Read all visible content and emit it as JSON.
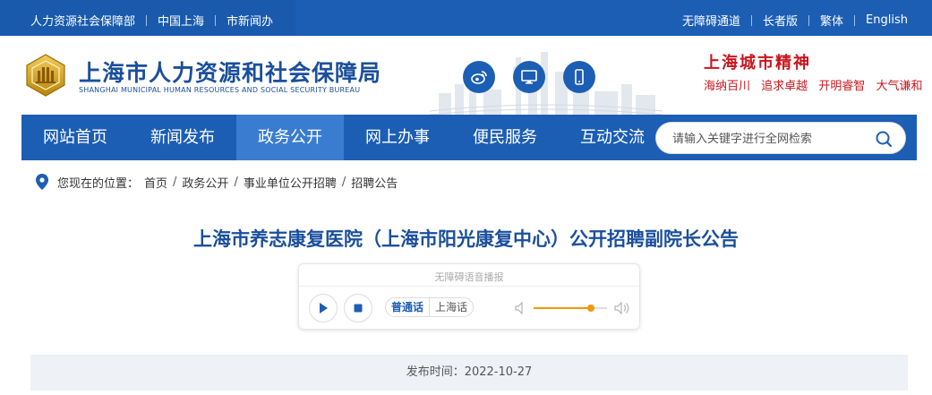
{
  "topbar": {
    "left_links": [
      "人力资源社会保障部",
      "中国上海",
      "市新闻办"
    ],
    "right_links": [
      "无障碍通道",
      "长者版",
      "繁体",
      "English"
    ]
  },
  "header": {
    "title_cn": "上海市人力资源和社会保障局",
    "title_en": "SHANGHAI MUNICIPAL HUMAN RESOURCES AND SOCIAL SECURITY BUREAU",
    "spirit_title": "上海城市精神",
    "spirit_items": [
      "海纳百川",
      "追求卓越",
      "开明睿智",
      "大气谦和"
    ],
    "icons": [
      "weibo-icon",
      "desktop-icon",
      "mobile-icon"
    ]
  },
  "nav": {
    "items": [
      "网站首页",
      "新闻发布",
      "政务公开",
      "网上办事",
      "便民服务",
      "互动交流"
    ],
    "active_index": 2,
    "search_placeholder": "请输入关键字进行全网检索"
  },
  "breadcrumb": {
    "prefix": "您现在的位置：",
    "items": [
      "首页",
      "政务公开",
      "事业单位公开招聘",
      "招聘公告"
    ]
  },
  "article": {
    "title": "上海市养志康复医院（上海市阳光康复中心）公开招聘副院长公告",
    "publish_time": "发布时间：2022-10-27"
  },
  "player": {
    "title": "无障碍语音播报",
    "lang_active": "普通话",
    "lang_other": "上海话",
    "volume_level": 0.78
  },
  "colors": {
    "primary": "#1c5eb4",
    "nav_active": "#3a7cd0",
    "title_blue": "#1b4f9c",
    "accent_red": "#c8161d",
    "volume_orange": "#f39800"
  }
}
